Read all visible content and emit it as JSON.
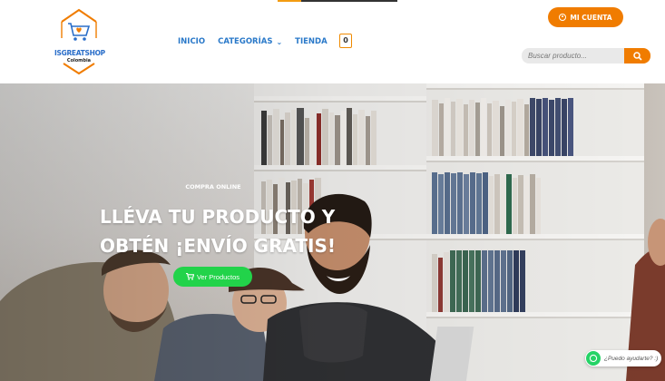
{
  "header": {
    "logo": {
      "name": "ISGREATSHOP",
      "sub": "Colombia"
    },
    "nav": [
      {
        "label": "INICIO"
      },
      {
        "label": "CATEGORÍAS"
      },
      {
        "label": "TIENDA"
      }
    ],
    "cart_count": "0",
    "account_label": "MI CUENTA",
    "search": {
      "placeholder": "Buscar producto..."
    }
  },
  "hero": {
    "eyebrow": "COMPRA ONLINE",
    "headline_line1": "LLÉVA TU PRODUCTO Y",
    "headline_line2": "OBTÉN ¡ENVÍO GRATIS!",
    "cta_label": "Ver Productos"
  },
  "whatsapp": {
    "label": "¿Puedo ayudarte? :)"
  },
  "colors": {
    "accent_orange": "#f07c00",
    "nav_blue": "#2a79c9",
    "cta_green": "#22d34a",
    "whatsapp_green": "#25d366"
  },
  "icons": [
    "cart-icon",
    "user-icon",
    "search-icon",
    "chevron-down-icon",
    "whatsapp-icon"
  ]
}
